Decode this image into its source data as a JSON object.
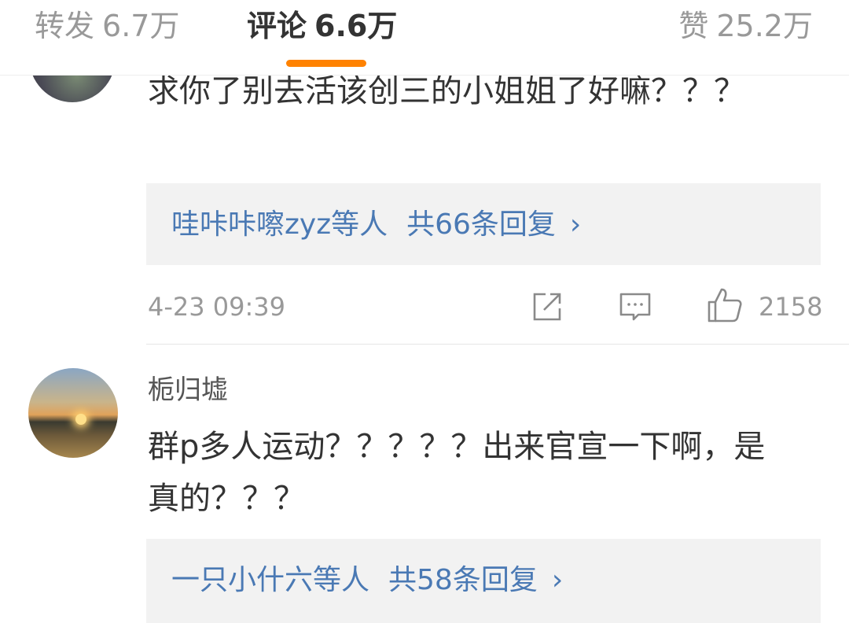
{
  "tabs": {
    "reposts": {
      "label": "转发",
      "count": "6.7万"
    },
    "comments": {
      "label": "评论",
      "count": "6.6万"
    },
    "likes": {
      "label": "赞",
      "count": "25.2万"
    },
    "accent_color": "#ff8200"
  },
  "comments": [
    {
      "text": "求你了别去活该创三的小姐姐了好嘛？？？",
      "replies": {
        "names": "哇咔咔嚓zyz等人",
        "count": "共66条回复",
        "chevron": "›"
      },
      "time": "4-23 09:39",
      "likes": "2158"
    },
    {
      "username": "栀归墟",
      "text": "群p多人运动？？？？？出来官宣一下啊，是真的？？？",
      "replies": {
        "names": "一只小什六等人",
        "count": "共58条回复",
        "chevron": "›"
      }
    }
  ],
  "icons": [
    "share-icon",
    "comment-icon",
    "thumbs-up-icon",
    "chevron-right-icon"
  ],
  "colors": {
    "link": "#4a79b4",
    "muted": "#999999",
    "reply_bg": "#f2f2f2"
  }
}
